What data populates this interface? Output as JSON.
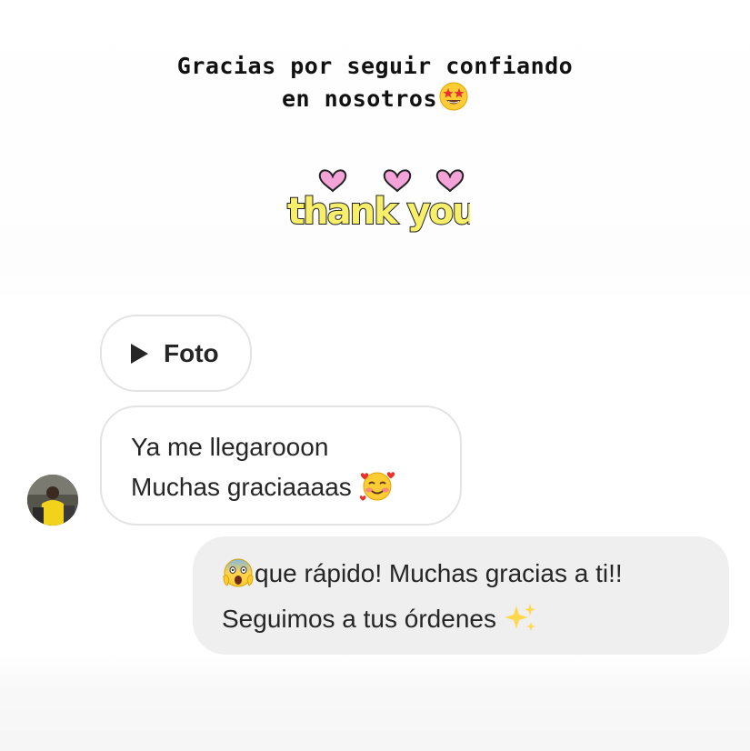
{
  "story": {
    "caption_line1": "Gracias por seguir confiando",
    "caption_line2": "en nosotros",
    "caption_emoji": "star-struck-emoji",
    "sticker_text": "thank you",
    "sticker_icon": "hearts-thank-you-sticker"
  },
  "chat": {
    "photo_bubble": {
      "label": "Foto",
      "icon": "play-icon"
    },
    "incoming_message": {
      "line1": "Ya me llegarooon",
      "line2": "Muchas graciaaaas",
      "emoji": "smiling-face-with-hearts-emoji"
    },
    "sender_avatar": "avatar",
    "outgoing_message": {
      "line1_emoji": "screaming-face-emoji",
      "line1": "que rápido! Muchas gracias a ti!!",
      "line2": "Seguimos a tus órdenes",
      "line2_emoji": "sparkles-emoji"
    }
  },
  "colors": {
    "incoming_bubble_bg": "#ffffff",
    "incoming_bubble_border": "#e3e3e3",
    "outgoing_bubble_bg": "#efefef",
    "text": "#262626",
    "sticker_yellow": "#f7ef6a",
    "sticker_pink": "#f4a3d9"
  }
}
